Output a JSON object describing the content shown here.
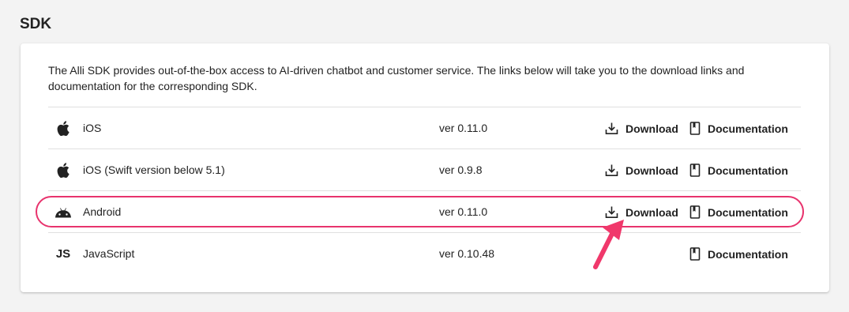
{
  "section": {
    "title": "SDK"
  },
  "card": {
    "description_line1": "The Alli SDK provides out-of-the-box access to AI-driven chatbot and customer service. The links below will take you to the download links and",
    "description_line2": "documentation for the corresponding SDK."
  },
  "rows": [
    {
      "icon": "apple-icon",
      "name": "iOS",
      "version": "ver 0.11.0",
      "download": "Download",
      "documentation": "Documentation"
    },
    {
      "icon": "apple-icon",
      "name": "iOS (Swift version below 5.1)",
      "version": "ver 0.9.8",
      "download": "Download",
      "documentation": "Documentation"
    },
    {
      "icon": "android-icon",
      "name": "Android",
      "version": "ver 0.11.0",
      "download": "Download",
      "documentation": "Documentation"
    },
    {
      "icon": "js-icon",
      "icon_text": "JS",
      "name": "JavaScript",
      "version": "ver 0.10.48",
      "documentation": "Documentation"
    }
  ],
  "colors": {
    "highlight": "#e8336d",
    "card_bg": "#ffffff",
    "page_bg": "#f3f3f3"
  }
}
